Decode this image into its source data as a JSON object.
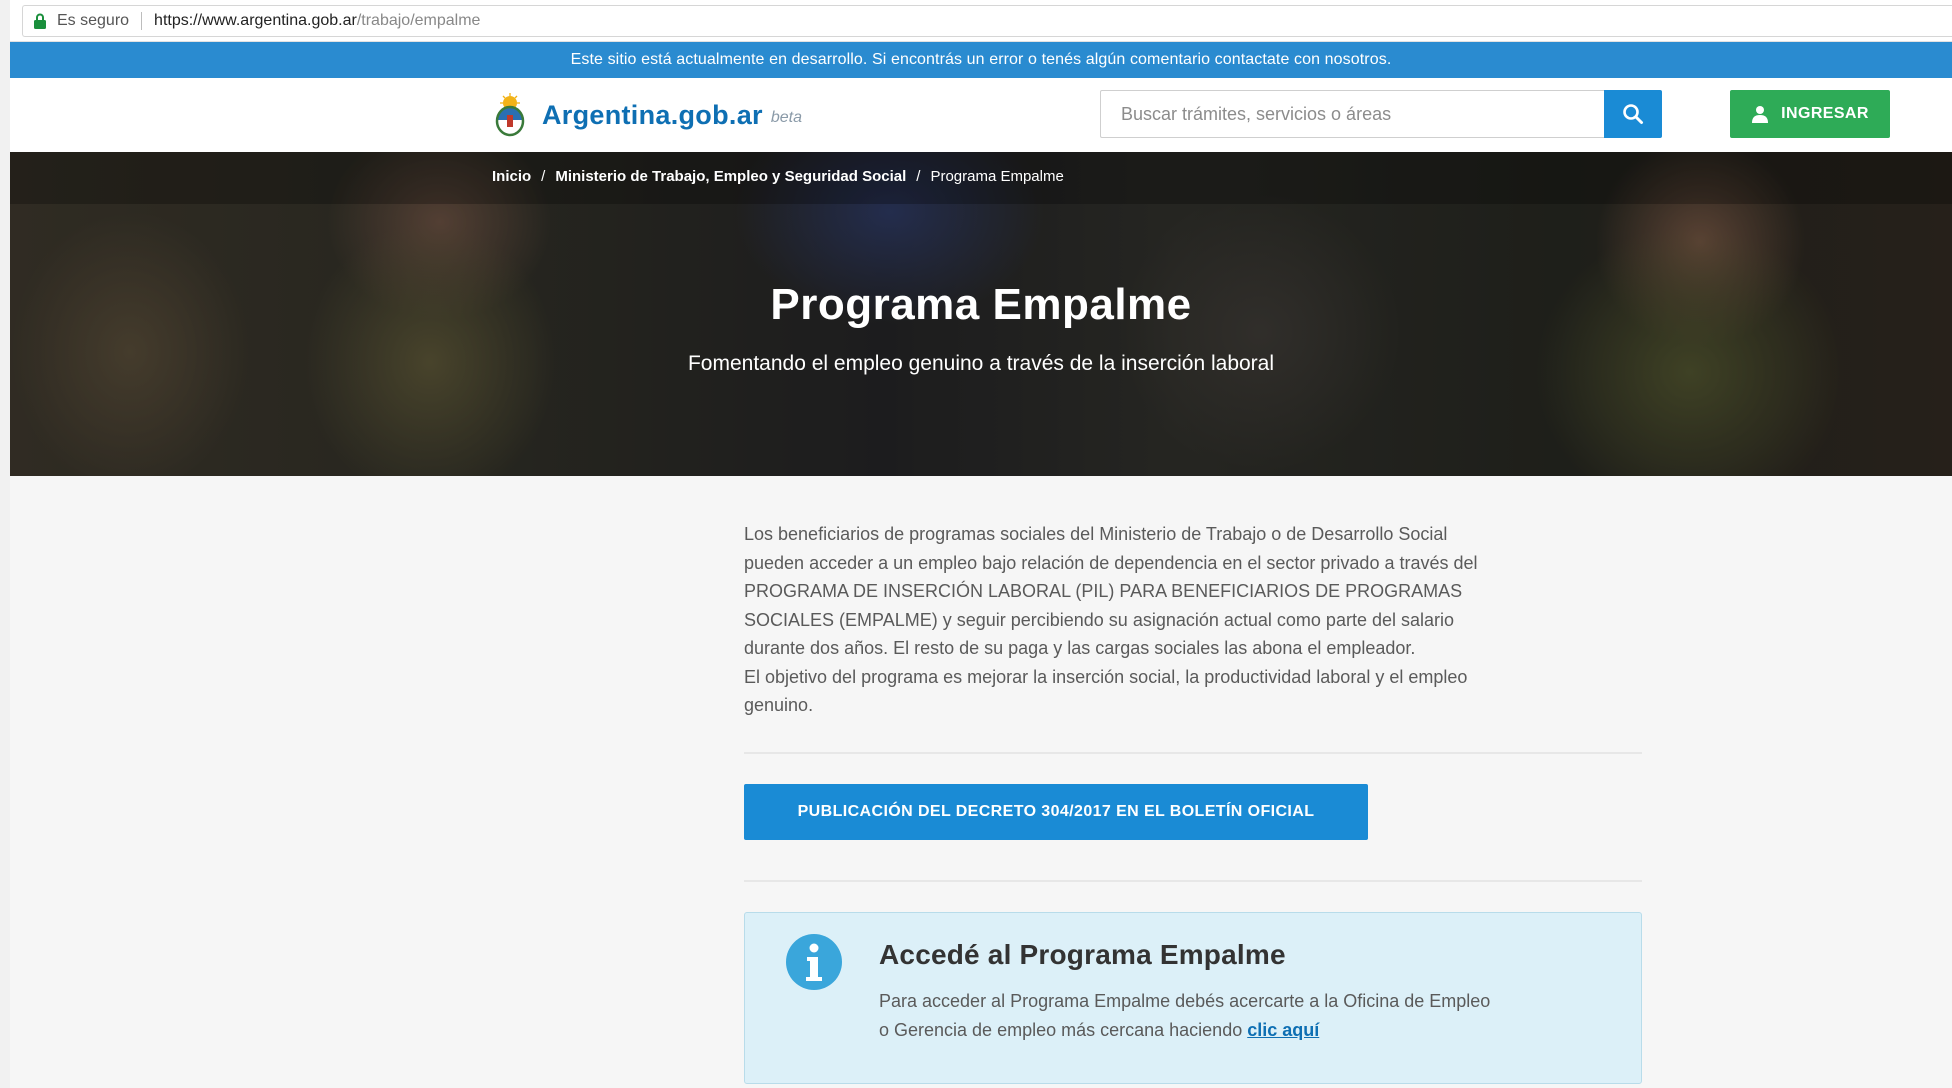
{
  "browser": {
    "secure_label": "Es seguro",
    "url_base": "https://www.argentina.gob.ar",
    "url_path": "/trabajo/empalme"
  },
  "notice": {
    "text": "Este sitio está actualmente en desarrollo. Si encontrás un error o tenés algún comentario contactate con nosotros."
  },
  "header": {
    "brand_name": "Argentina.gob.ar",
    "brand_tag": "beta",
    "search_placeholder": "Buscar trámites, servicios o áreas",
    "search_icon": "search-icon",
    "login_label": "INGRESAR",
    "login_icon": "user-icon"
  },
  "hero": {
    "breadcrumb": [
      {
        "label": "Inicio"
      },
      {
        "label": "Ministerio de Trabajo, Empleo y Seguridad Social"
      },
      {
        "label": "Programa Empalme"
      }
    ],
    "breadcrumb_separator": "/",
    "title": "Programa Empalme",
    "subtitle": "Fomentando el empleo genuino a través de la inserción laboral"
  },
  "content": {
    "intro_lines": [
      "Los beneficiarios de programas sociales del Ministerio de Trabajo o de Desarrollo Social",
      "pueden acceder a un empleo bajo relación de dependencia en el sector privado a través del",
      "PROGRAMA DE INSERCIÓN LABORAL (PIL) PARA BENEFICIARIOS DE PROGRAMAS",
      "SOCIALES (EMPALME) y seguir percibiendo su asignación actual como parte del salario",
      "durante dos años. El resto de su paga y las cargas sociales las abona el empleador.",
      "El objetivo del programa es mejorar la inserción social, la productividad laboral y el empleo",
      "genuino."
    ],
    "doc_button_label": "PUBLICACIÓN DEL DECRETO 304/2017 EN EL BOLETÍN OFICIAL",
    "info": {
      "icon": "info-icon",
      "title": "Accedé al Programa Empalme",
      "text_line1": "Para acceder al Programa Empalme debés acercarte a la Oficina de Empleo",
      "text_line2_prefix": "o Gerencia de empleo más cercana haciendo ",
      "link_label": "clic aquí"
    }
  },
  "colors": {
    "notice_bg": "#2a8bd0",
    "brand_blue": "#0e6fb3",
    "primary_button": "#1a8bd5",
    "login_green": "#2eab57",
    "info_bg": "#dcf0f8",
    "page_bg": "#f6f6f6"
  }
}
